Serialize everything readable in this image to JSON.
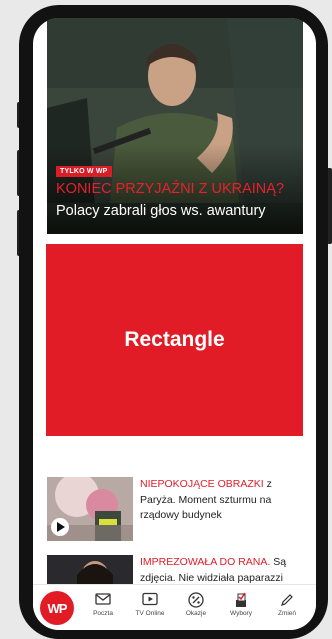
{
  "hero": {
    "badge": "TYLKO W WP",
    "kicker": "KONIEC PRZYJAŹNI Z UKRAINĄ?",
    "title": "Polacy zabrali głos ws. awantury"
  },
  "ad": {
    "label": "Rectangle"
  },
  "articles": [
    {
      "kicker": "NIEPOKOJĄCE OBRAZKI",
      "text": " z Paryża. Moment szturmu na rządowy budynek",
      "has_video": true
    },
    {
      "kicker": "IMPREZOWAŁA DO RANA.",
      "text": " Są zdjęcia. Nie widziała paparazzi",
      "has_video": false
    }
  ],
  "bottom_nav": {
    "logo": "WP",
    "items": [
      {
        "label": "Poczta",
        "icon": "mail-icon"
      },
      {
        "label": "TV Online",
        "icon": "play-icon"
      },
      {
        "label": "Okazje",
        "icon": "percent-icon"
      },
      {
        "label": "Wybory",
        "icon": "ballot-icon"
      },
      {
        "label": "Zmień",
        "icon": "pencil-icon"
      }
    ]
  },
  "colors": {
    "brand": "#e21c26",
    "frame": "#121212"
  }
}
